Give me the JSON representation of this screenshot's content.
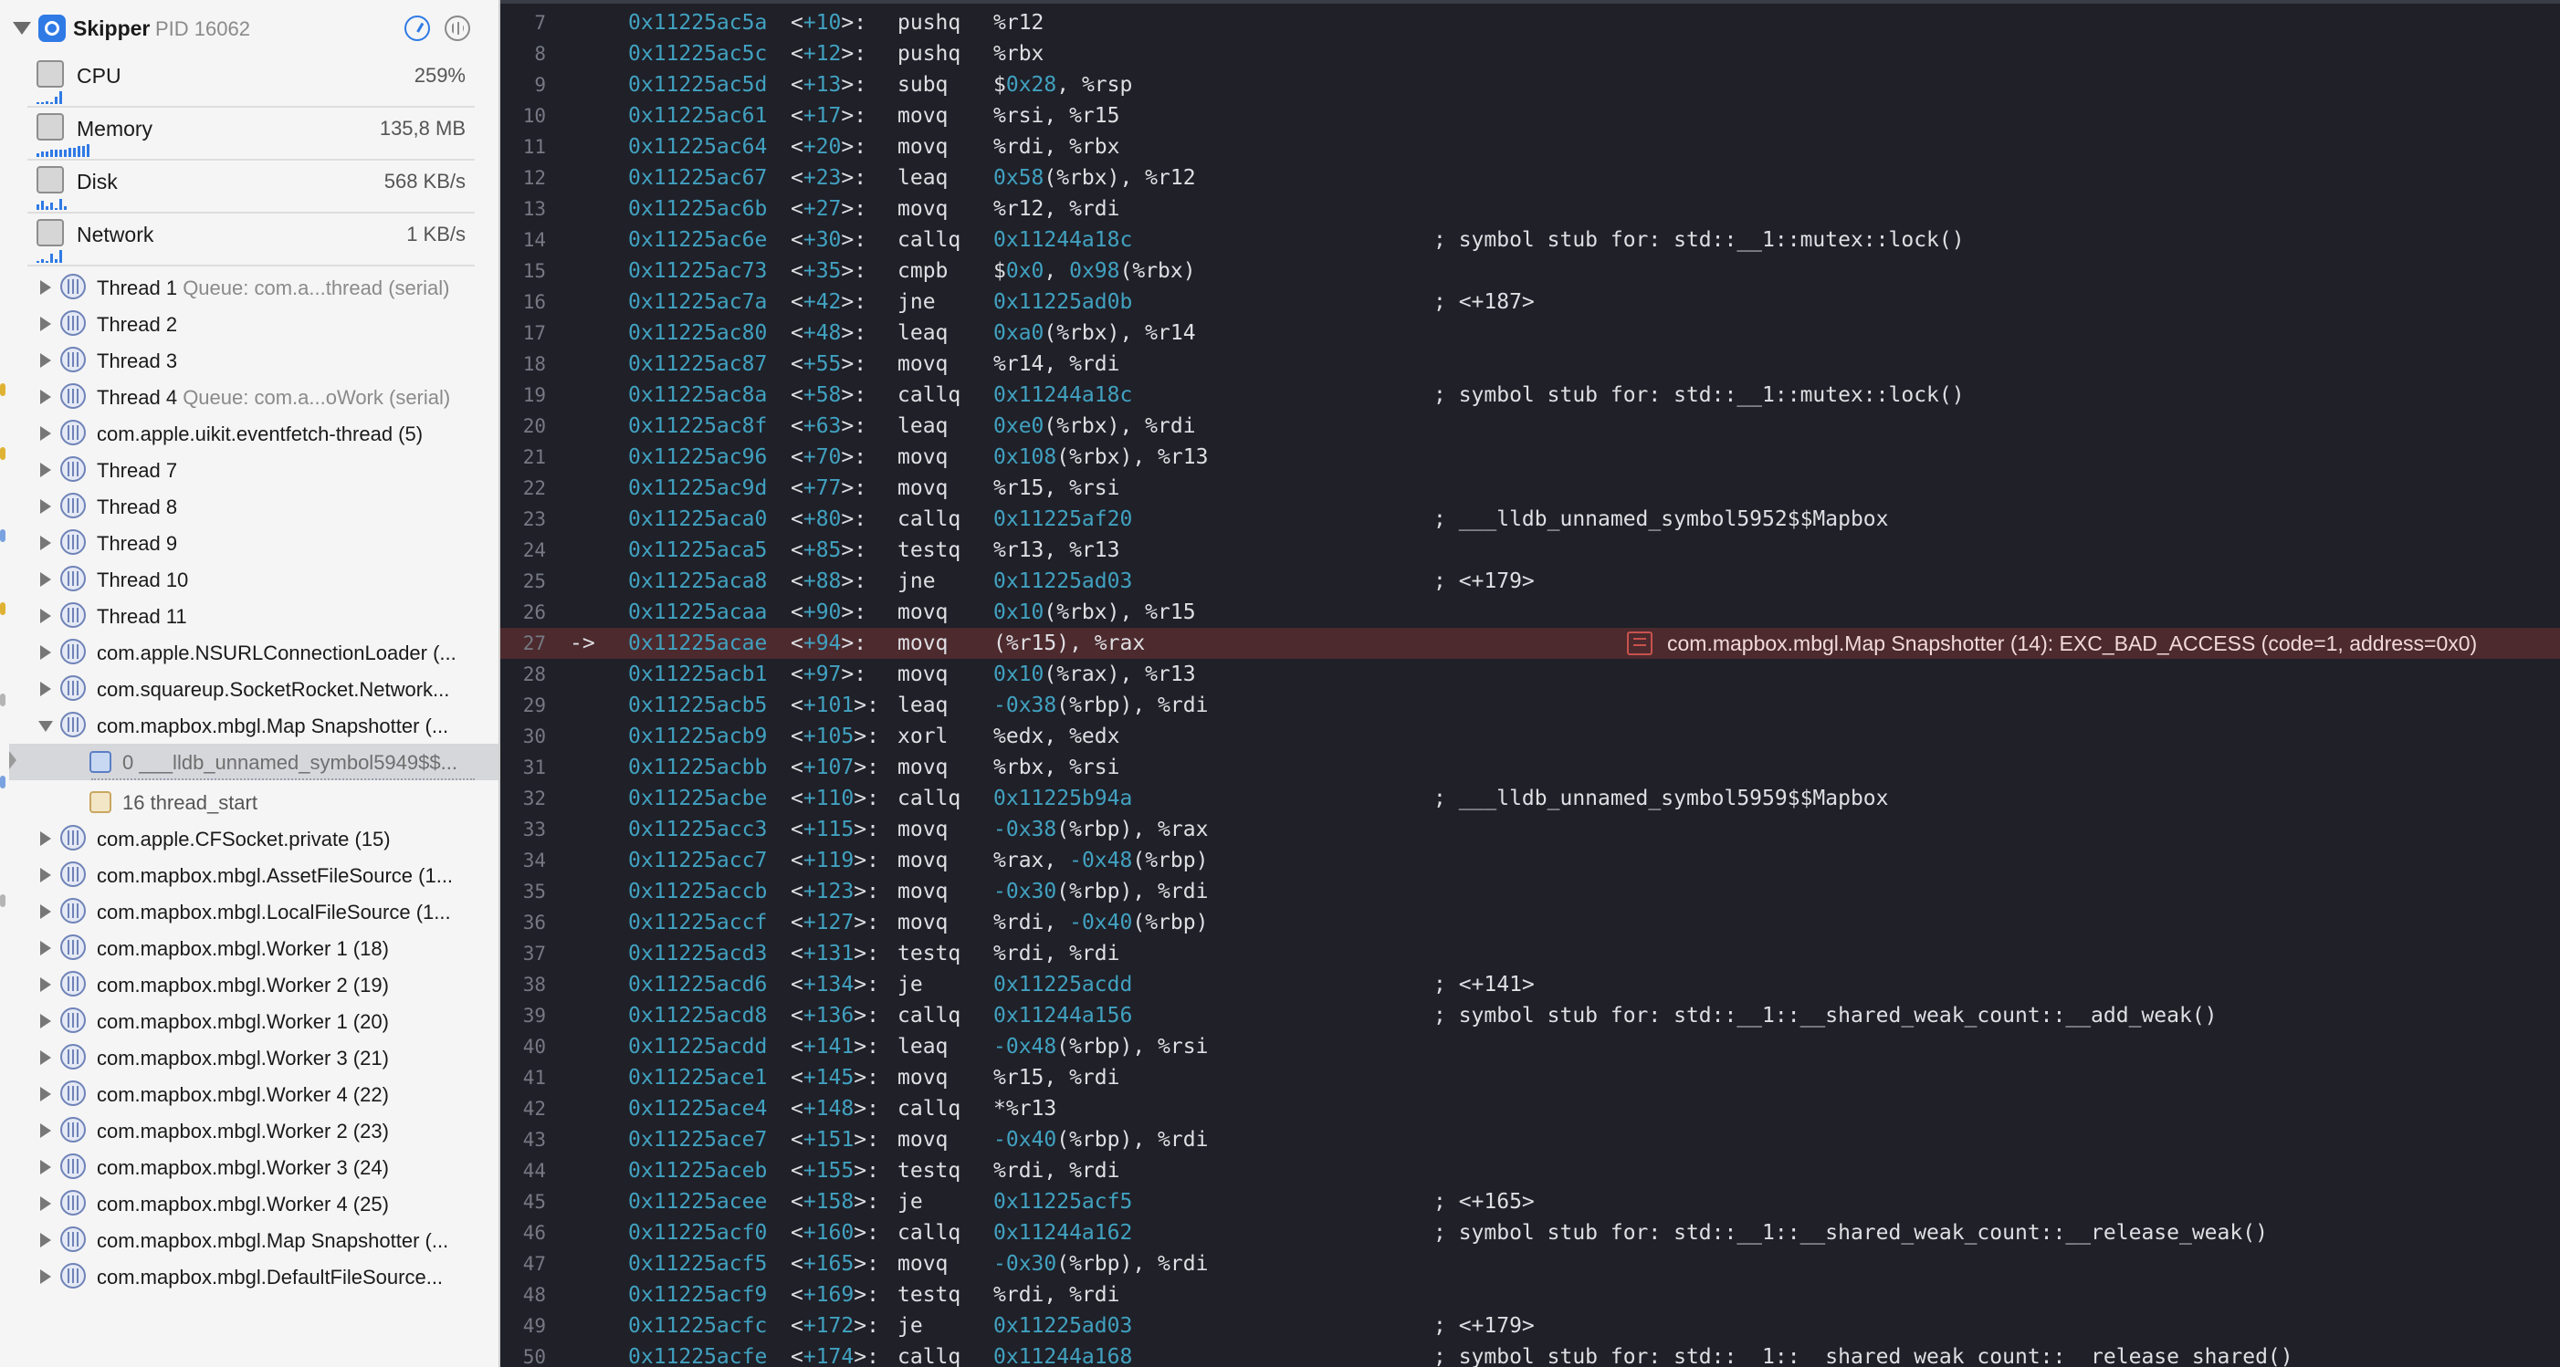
{
  "process": {
    "name": "Skipper",
    "pid_label": "PID 16062",
    "accent_color": "#2f7ae5",
    "disclosure_icon": "disclosure-down-icon",
    "buttons": [
      "debug-gauge-icon",
      "thread-view-icon"
    ]
  },
  "gauges": [
    {
      "label": "CPU",
      "value": "259%",
      "icon": "cpu-icon"
    },
    {
      "label": "Memory",
      "value": "135,8 MB",
      "icon": "memory-icon"
    },
    {
      "label": "Disk",
      "value": "568 KB/s",
      "icon": "disk-icon"
    },
    {
      "label": "Network",
      "value": "1 KB/s",
      "icon": "network-icon"
    }
  ],
  "threads": [
    {
      "name": "Thread 1",
      "queue": "Queue: com.a...thread (serial)"
    },
    {
      "name": "Thread 2",
      "queue": ""
    },
    {
      "name": "Thread 3",
      "queue": ""
    },
    {
      "name": "Thread 4",
      "queue": "Queue: com.a...oWork (serial)"
    },
    {
      "name": "com.apple.uikit.eventfetch-thread (5)",
      "queue": ""
    },
    {
      "name": "Thread 7",
      "queue": ""
    },
    {
      "name": "Thread 8",
      "queue": ""
    },
    {
      "name": "Thread 9",
      "queue": ""
    },
    {
      "name": "Thread 10",
      "queue": ""
    },
    {
      "name": "Thread 11",
      "queue": ""
    },
    {
      "name": "com.apple.NSURLConnectionLoader (...",
      "queue": ""
    },
    {
      "name": "com.squareup.SocketRocket.Network...",
      "queue": ""
    },
    {
      "name": "com.mapbox.mbgl.Map Snapshotter (...",
      "queue": "",
      "expanded": true
    },
    {
      "name": "com.apple.CFSocket.private (15)",
      "queue": ""
    },
    {
      "name": "com.mapbox.mbgl.AssetFileSource (1...",
      "queue": ""
    },
    {
      "name": "com.mapbox.mbgl.LocalFileSource (1...",
      "queue": ""
    },
    {
      "name": "com.mapbox.mbgl.Worker 1 (18)",
      "queue": ""
    },
    {
      "name": "com.mapbox.mbgl.Worker 2 (19)",
      "queue": ""
    },
    {
      "name": "com.mapbox.mbgl.Worker 1 (20)",
      "queue": ""
    },
    {
      "name": "com.mapbox.mbgl.Worker 3 (21)",
      "queue": ""
    },
    {
      "name": "com.mapbox.mbgl.Worker 4 (22)",
      "queue": ""
    },
    {
      "name": "com.mapbox.mbgl.Worker 2 (23)",
      "queue": ""
    },
    {
      "name": "com.mapbox.mbgl.Worker 3 (24)",
      "queue": ""
    },
    {
      "name": "com.mapbox.mbgl.Worker 4 (25)",
      "queue": ""
    },
    {
      "name": "com.mapbox.mbgl.Map Snapshotter (...",
      "queue": ""
    },
    {
      "name": "com.mapbox.mbgl.DefaultFileSource...",
      "queue": ""
    }
  ],
  "frames": [
    {
      "label": "0 ___lldb_unnamed_symbol5949$$...",
      "kind": "user",
      "selected": true
    },
    {
      "label": "16 thread_start",
      "kind": "sys",
      "selected": false
    }
  ],
  "crash": {
    "line": "27",
    "message": "com.mapbox.mbgl.Map Snapshotter (14): EXC_BAD_ACCESS (code=1, address=0x0)",
    "color": "#4c2a2e"
  },
  "disassembly": [
    {
      "n": "7",
      "addr": "0x11225ac5a",
      "off": "+10",
      "mn": "pushq",
      "ops": "%r12",
      "c": ""
    },
    {
      "n": "8",
      "addr": "0x11225ac5c",
      "off": "+12",
      "mn": "pushq",
      "ops": "%rbx",
      "c": ""
    },
    {
      "n": "9",
      "addr": "0x11225ac5d",
      "off": "+13",
      "mn": "subq",
      "ops": "$0x28, %rsp",
      "c": ""
    },
    {
      "n": "10",
      "addr": "0x11225ac61",
      "off": "+17",
      "mn": "movq",
      "ops": "%rsi, %r15",
      "c": ""
    },
    {
      "n": "11",
      "addr": "0x11225ac64",
      "off": "+20",
      "mn": "movq",
      "ops": "%rdi, %rbx",
      "c": ""
    },
    {
      "n": "12",
      "addr": "0x11225ac67",
      "off": "+23",
      "mn": "leaq",
      "ops": "0x58(%rbx), %r12",
      "c": ""
    },
    {
      "n": "13",
      "addr": "0x11225ac6b",
      "off": "+27",
      "mn": "movq",
      "ops": "%r12, %rdi",
      "c": ""
    },
    {
      "n": "14",
      "addr": "0x11225ac6e",
      "off": "+30",
      "mn": "callq",
      "ops": "0x11244a18c",
      "c": "; symbol stub for: std::__1::mutex::lock()"
    },
    {
      "n": "15",
      "addr": "0x11225ac73",
      "off": "+35",
      "mn": "cmpb",
      "ops": "$0x0, 0x98(%rbx)",
      "c": ""
    },
    {
      "n": "16",
      "addr": "0x11225ac7a",
      "off": "+42",
      "mn": "jne",
      "ops": "0x11225ad0b",
      "c": "; <+187>"
    },
    {
      "n": "17",
      "addr": "0x11225ac80",
      "off": "+48",
      "mn": "leaq",
      "ops": "0xa0(%rbx), %r14",
      "c": ""
    },
    {
      "n": "18",
      "addr": "0x11225ac87",
      "off": "+55",
      "mn": "movq",
      "ops": "%r14, %rdi",
      "c": ""
    },
    {
      "n": "19",
      "addr": "0x11225ac8a",
      "off": "+58",
      "mn": "callq",
      "ops": "0x11244a18c",
      "c": "; symbol stub for: std::__1::mutex::lock()"
    },
    {
      "n": "20",
      "addr": "0x11225ac8f",
      "off": "+63",
      "mn": "leaq",
      "ops": "0xe0(%rbx), %rdi",
      "c": ""
    },
    {
      "n": "21",
      "addr": "0x11225ac96",
      "off": "+70",
      "mn": "movq",
      "ops": "0x108(%rbx), %r13",
      "c": ""
    },
    {
      "n": "22",
      "addr": "0x11225ac9d",
      "off": "+77",
      "mn": "movq",
      "ops": "%r15, %rsi",
      "c": ""
    },
    {
      "n": "23",
      "addr": "0x11225aca0",
      "off": "+80",
      "mn": "callq",
      "ops": "0x11225af20",
      "c": "; ___lldb_unnamed_symbol5952$$Mapbox"
    },
    {
      "n": "24",
      "addr": "0x11225aca5",
      "off": "+85",
      "mn": "testq",
      "ops": "%r13, %r13",
      "c": ""
    },
    {
      "n": "25",
      "addr": "0x11225aca8",
      "off": "+88",
      "mn": "jne",
      "ops": "0x11225ad03",
      "c": "; <+179>"
    },
    {
      "n": "26",
      "addr": "0x11225acaa",
      "off": "+90",
      "mn": "movq",
      "ops": "0x10(%rbx), %r15",
      "c": ""
    },
    {
      "n": "27",
      "addr": "0x11225acae",
      "off": "+94",
      "mn": "movq",
      "ops": "(%r15), %rax",
      "c": "",
      "arrow": "->"
    },
    {
      "n": "28",
      "addr": "0x11225acb1",
      "off": "+97",
      "mn": "movq",
      "ops": "0x10(%rax), %r13",
      "c": ""
    },
    {
      "n": "29",
      "addr": "0x11225acb5",
      "off": "+101",
      "mn": "leaq",
      "ops": "-0x38(%rbp), %rdi",
      "c": ""
    },
    {
      "n": "30",
      "addr": "0x11225acb9",
      "off": "+105",
      "mn": "xorl",
      "ops": "%edx, %edx",
      "c": ""
    },
    {
      "n": "31",
      "addr": "0x11225acbb",
      "off": "+107",
      "mn": "movq",
      "ops": "%rbx, %rsi",
      "c": ""
    },
    {
      "n": "32",
      "addr": "0x11225acbe",
      "off": "+110",
      "mn": "callq",
      "ops": "0x11225b94a",
      "c": "; ___lldb_unnamed_symbol5959$$Mapbox"
    },
    {
      "n": "33",
      "addr": "0x11225acc3",
      "off": "+115",
      "mn": "movq",
      "ops": "-0x38(%rbp), %rax",
      "c": ""
    },
    {
      "n": "34",
      "addr": "0x11225acc7",
      "off": "+119",
      "mn": "movq",
      "ops": "%rax, -0x48(%rbp)",
      "c": ""
    },
    {
      "n": "35",
      "addr": "0x11225accb",
      "off": "+123",
      "mn": "movq",
      "ops": "-0x30(%rbp), %rdi",
      "c": ""
    },
    {
      "n": "36",
      "addr": "0x11225accf",
      "off": "+127",
      "mn": "movq",
      "ops": "%rdi, -0x40(%rbp)",
      "c": ""
    },
    {
      "n": "37",
      "addr": "0x11225acd3",
      "off": "+131",
      "mn": "testq",
      "ops": "%rdi, %rdi",
      "c": ""
    },
    {
      "n": "38",
      "addr": "0x11225acd6",
      "off": "+134",
      "mn": "je",
      "ops": "0x11225acdd",
      "c": "; <+141>"
    },
    {
      "n": "39",
      "addr": "0x11225acd8",
      "off": "+136",
      "mn": "callq",
      "ops": "0x11244a156",
      "c": "; symbol stub for: std::__1::__shared_weak_count::__add_weak()"
    },
    {
      "n": "40",
      "addr": "0x11225acdd",
      "off": "+141",
      "mn": "leaq",
      "ops": "-0x48(%rbp), %rsi",
      "c": ""
    },
    {
      "n": "41",
      "addr": "0x11225ace1",
      "off": "+145",
      "mn": "movq",
      "ops": "%r15, %rdi",
      "c": ""
    },
    {
      "n": "42",
      "addr": "0x11225ace4",
      "off": "+148",
      "mn": "callq",
      "ops": "*%r13",
      "c": ""
    },
    {
      "n": "43",
      "addr": "0x11225ace7",
      "off": "+151",
      "mn": "movq",
      "ops": "-0x40(%rbp), %rdi",
      "c": ""
    },
    {
      "n": "44",
      "addr": "0x11225aceb",
      "off": "+155",
      "mn": "testq",
      "ops": "%rdi, %rdi",
      "c": ""
    },
    {
      "n": "45",
      "addr": "0x11225acee",
      "off": "+158",
      "mn": "je",
      "ops": "0x11225acf5",
      "c": "; <+165>"
    },
    {
      "n": "46",
      "addr": "0x11225acf0",
      "off": "+160",
      "mn": "callq",
      "ops": "0x11244a162",
      "c": "; symbol stub for: std::__1::__shared_weak_count::__release_weak()"
    },
    {
      "n": "47",
      "addr": "0x11225acf5",
      "off": "+165",
      "mn": "movq",
      "ops": "-0x30(%rbp), %rdi",
      "c": ""
    },
    {
      "n": "48",
      "addr": "0x11225acf9",
      "off": "+169",
      "mn": "testq",
      "ops": "%rdi, %rdi",
      "c": ""
    },
    {
      "n": "49",
      "addr": "0x11225acfc",
      "off": "+172",
      "mn": "je",
      "ops": "0x11225ad03",
      "c": "; <+179>"
    },
    {
      "n": "50",
      "addr": "0x11225acfe",
      "off": "+174",
      "mn": "callq",
      "ops": "0x11244a168",
      "c": "; symbol stub for: std::__1::__shared_weak_count::__release_shared()"
    }
  ]
}
